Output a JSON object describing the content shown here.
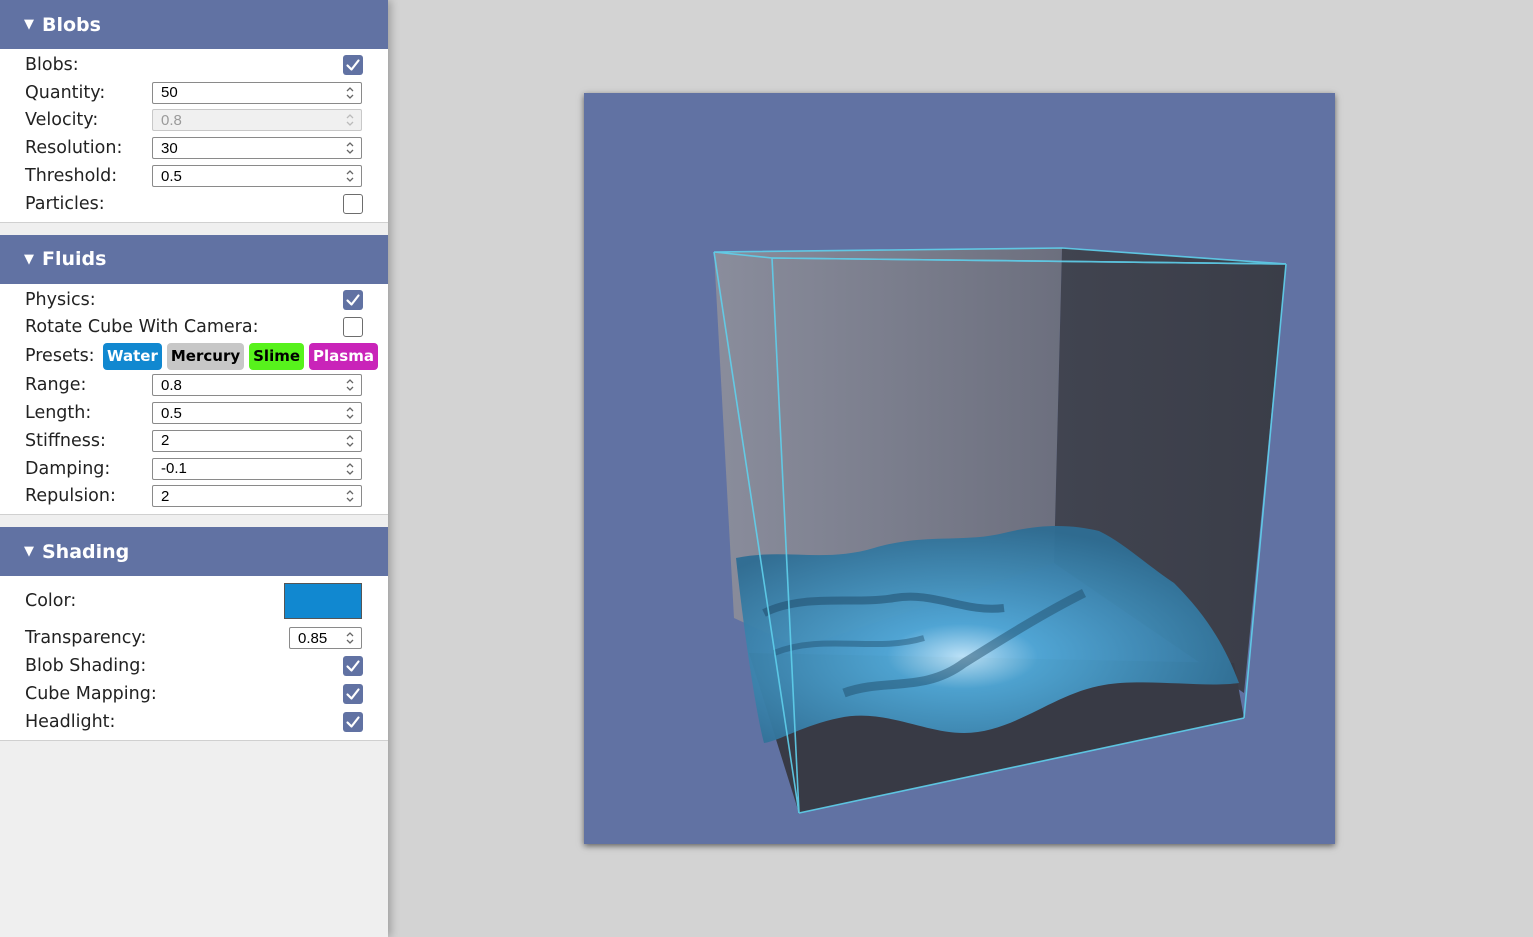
{
  "colors": {
    "header_bg": "#6172a3",
    "viewport_bg": "#6172a3",
    "fluid_color": "#1188d0",
    "cube_edge": "#5fd0ec",
    "water_btn": "#1188d0",
    "mercury_btn": "#c7c7c7",
    "slime_btn": "#57f21c",
    "plasma_btn": "#c924b9"
  },
  "blobs": {
    "header": "Blobs",
    "toggle_icon": "triangle-down-icon",
    "blobs_label": "Blobs:",
    "blobs_checked": true,
    "quantity_label": "Quantity:",
    "quantity_value": "50",
    "velocity_label": "Velocity:",
    "velocity_value": "0.8",
    "velocity_disabled": true,
    "resolution_label": "Resolution:",
    "resolution_value": "30",
    "threshold_label": "Threshold:",
    "threshold_value": "0.5",
    "particles_label": "Particles:",
    "particles_checked": false
  },
  "fluids": {
    "header": "Fluids",
    "physics_label": "Physics:",
    "physics_checked": true,
    "rotate_label": "Rotate Cube With Camera:",
    "rotate_checked": false,
    "presets_label": "Presets:",
    "presets": [
      "Water",
      "Mercury",
      "Slime",
      "Plasma"
    ],
    "range_label": "Range:",
    "range_value": "0.8",
    "length_label": "Length:",
    "length_value": "0.5",
    "stiffness_label": "Stiffness:",
    "stiffness_value": "2",
    "damping_label": "Damping:",
    "damping_value": "-0.1",
    "repulsion_label": "Repulsion:",
    "repulsion_value": "2"
  },
  "shading": {
    "header": "Shading",
    "color_label": "Color:",
    "color_value": "#1188d0",
    "transparency_label": "Transparency:",
    "transparency_value": "0.85",
    "blob_shading_label": "Blob Shading:",
    "blob_shading_checked": true,
    "cube_mapping_label": "Cube Mapping:",
    "cube_mapping_checked": true,
    "headlight_label": "Headlight:",
    "headlight_checked": true
  }
}
